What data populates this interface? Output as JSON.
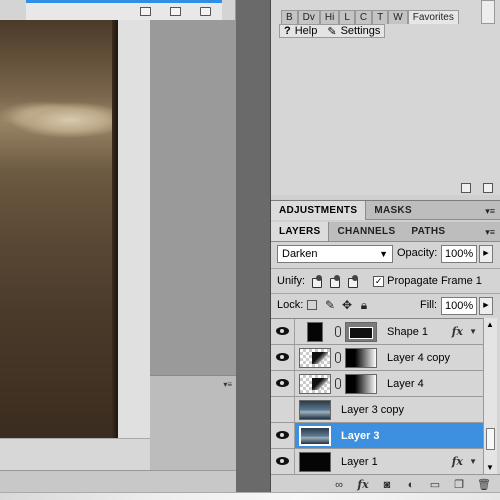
{
  "top_panel": {
    "tabs": [
      "B",
      "Dv",
      "Hi",
      "L",
      "C",
      "T",
      "W",
      "Favorites"
    ],
    "help_label": "Help",
    "settings_label": "Settings"
  },
  "adjustments_bar": {
    "tabs": [
      "ADJUSTMENTS",
      "MASKS"
    ]
  },
  "layers_panel": {
    "tabs": [
      "LAYERS",
      "CHANNELS",
      "PATHS"
    ],
    "blend_mode": "Darken",
    "opacity_label": "Opacity:",
    "opacity_value": "100%",
    "unify_label": "Unify:",
    "propagate_label": "Propagate Frame 1",
    "propagate_checked": true,
    "lock_label": "Lock:",
    "fill_label": "Fill:",
    "fill_value": "100%",
    "layers": [
      {
        "name": "Shape 1",
        "visible": true,
        "selected": false,
        "has_fx": true
      },
      {
        "name": "Layer 4 copy",
        "visible": true,
        "selected": false,
        "has_fx": false
      },
      {
        "name": "Layer 4",
        "visible": true,
        "selected": false,
        "has_fx": false
      },
      {
        "name": "Layer 3 copy",
        "visible": false,
        "selected": false,
        "has_fx": false
      },
      {
        "name": "Layer 3",
        "visible": true,
        "selected": true,
        "has_fx": false
      },
      {
        "name": "Layer 1",
        "visible": true,
        "selected": false,
        "has_fx": true
      }
    ],
    "footer_icons": [
      "link-icon",
      "fx-icon",
      "mask-icon",
      "adjustment-icon",
      "group-icon",
      "new-layer-icon",
      "trash-icon"
    ]
  },
  "colors": {
    "selected_row": "#3d8fe0",
    "panel_bg": "#d4d4d4",
    "canvas_bg": "#7b7b7b"
  }
}
